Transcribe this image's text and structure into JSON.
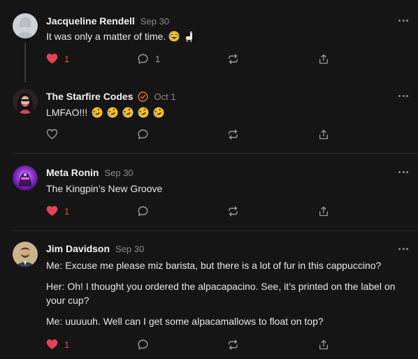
{
  "posts": [
    {
      "author": "Jacqueline Rendell",
      "date": "Sep 30",
      "text": "It was only a matter of time.",
      "emojis": [
        "laughing-tears",
        "llama"
      ],
      "likes": "1",
      "replies": "1",
      "liked": true,
      "verified": false
    },
    {
      "author": "The Starfire Codes",
      "date": "Oct 1",
      "text": "LMFAO!!!",
      "emojis": [
        "rofl",
        "rofl",
        "rofl",
        "rofl",
        "rofl"
      ],
      "likes": "",
      "replies": "",
      "liked": false,
      "verified": true
    },
    {
      "author": "Meta Ronin",
      "date": "Sep 30",
      "text": "The Kingpin’s New Groove",
      "likes": "1",
      "replies": "",
      "liked": true,
      "verified": false
    },
    {
      "author": "Jim Davidson",
      "date": "Sep 30",
      "paragraphs": [
        "Me: Excuse me please miz barista, but there is a lot of fur in this cappuccino?",
        "Her: Oh! I thought you ordered the alpacapacino. See, it’s printed on the label on your cup?",
        "Me: uuuuuh. Well can I get some alpacamallows to float on top?"
      ],
      "likes": "1",
      "replies": "",
      "liked": true,
      "verified": false
    }
  ],
  "colors": {
    "background": "#151516",
    "like_active": "#e8425a",
    "muted": "#8a8a8e",
    "verified": "#e8743b"
  },
  "icons": {
    "like": "heart-icon",
    "reply": "reply-bubble-icon",
    "repost": "repost-icon",
    "share": "share-icon",
    "more": "more-dots-icon",
    "verified": "verified-badge-icon"
  }
}
